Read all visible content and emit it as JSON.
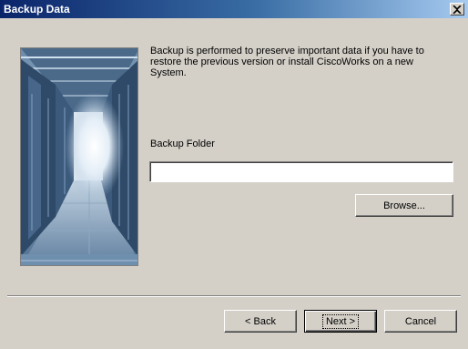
{
  "window": {
    "title": "Backup Data"
  },
  "icons": {
    "close": "close-icon",
    "side_image": "server-room-image"
  },
  "content": {
    "description": "Backup is performed to preserve important data if you have to restore the previous version or install CiscoWorks on a new System.",
    "folder_label": "Backup Folder",
    "folder_value": "",
    "browse_label": "Browse..."
  },
  "footer": {
    "back_label": "< Back",
    "next_label": "Next >",
    "cancel_label": "Cancel"
  },
  "colors": {
    "titlebar_start": "#0a246a",
    "titlebar_end": "#a6caf0",
    "dialog_face": "#d4d0c8"
  }
}
